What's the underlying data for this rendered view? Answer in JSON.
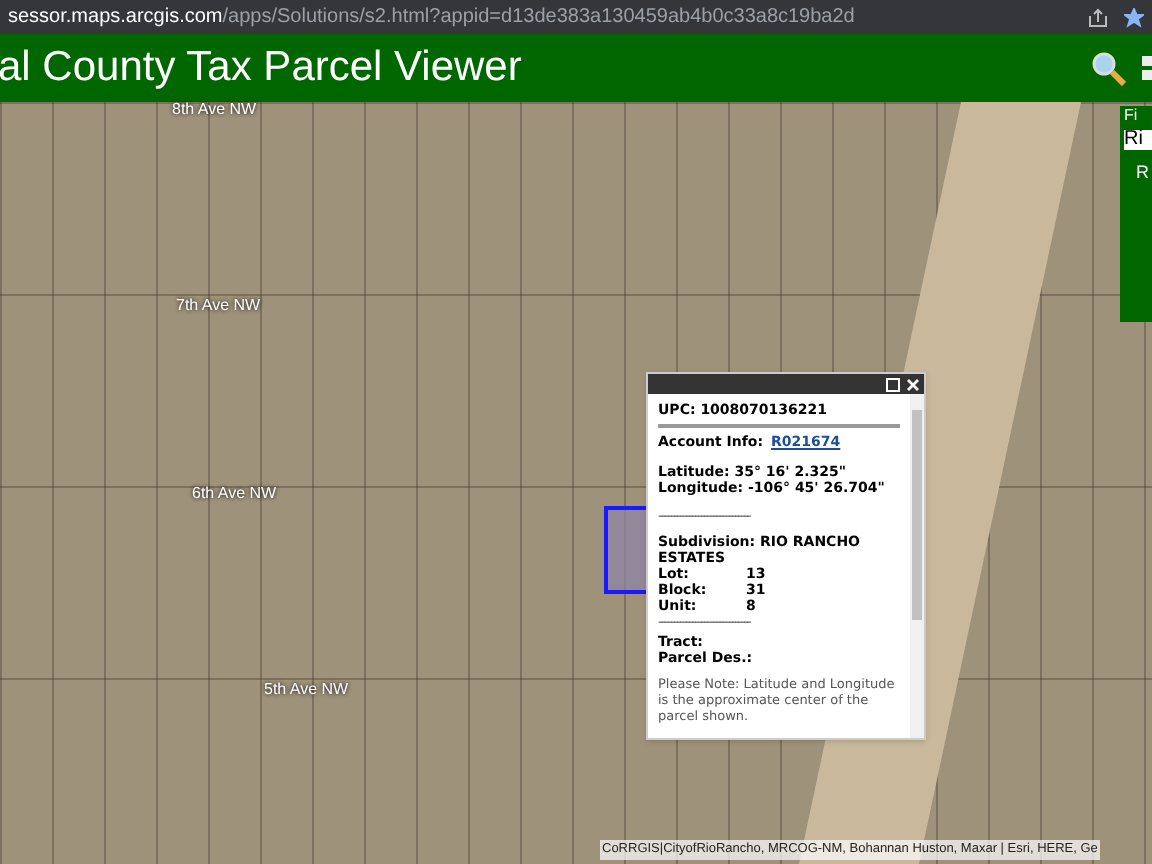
{
  "browser": {
    "url_host": "sessor.maps.arcgis.com",
    "url_path": "/apps/Solutions/s2.html?appid=d13de383a130459ab4b0c33a8c19ba2d",
    "bookmarked": true
  },
  "header": {
    "title": "al County Tax Parcel Viewer"
  },
  "map": {
    "street_labels": [
      {
        "text": "8th Ave NW"
      },
      {
        "text": "7th Ave NW"
      },
      {
        "text": "6th Ave NW"
      },
      {
        "text": "5th Ave NW"
      }
    ],
    "attribution": "CoRRGIS|CityofRioRancho, MRCOG-NM, Bohannan Huston, Maxar | Esri, HERE, Ge"
  },
  "side_panel": {
    "label": "Fi",
    "value": "Ri",
    "text": "R"
  },
  "popup": {
    "upc": "UPC: 1008070136221",
    "account_label": "Account Info:",
    "account_link": "R021674",
    "latitude": "Latitude: 35° 16' 2.325\"",
    "longitude": "Longitude: -106° 45' 26.704\"",
    "divider": "------------------------------",
    "subdivision": "Subdivision: RIO RANCHO ESTATES",
    "fields": [
      {
        "label": "Lot:",
        "value": "13"
      },
      {
        "label": "Block:",
        "value": "31"
      },
      {
        "label": "Unit:",
        "value": "8"
      }
    ],
    "divider2": "------------------------------",
    "tract": "Tract:",
    "parcel": "Parcel Des.:",
    "note": "Please Note: Latitude and Longitude is the approximate center of the parcel shown."
  }
}
